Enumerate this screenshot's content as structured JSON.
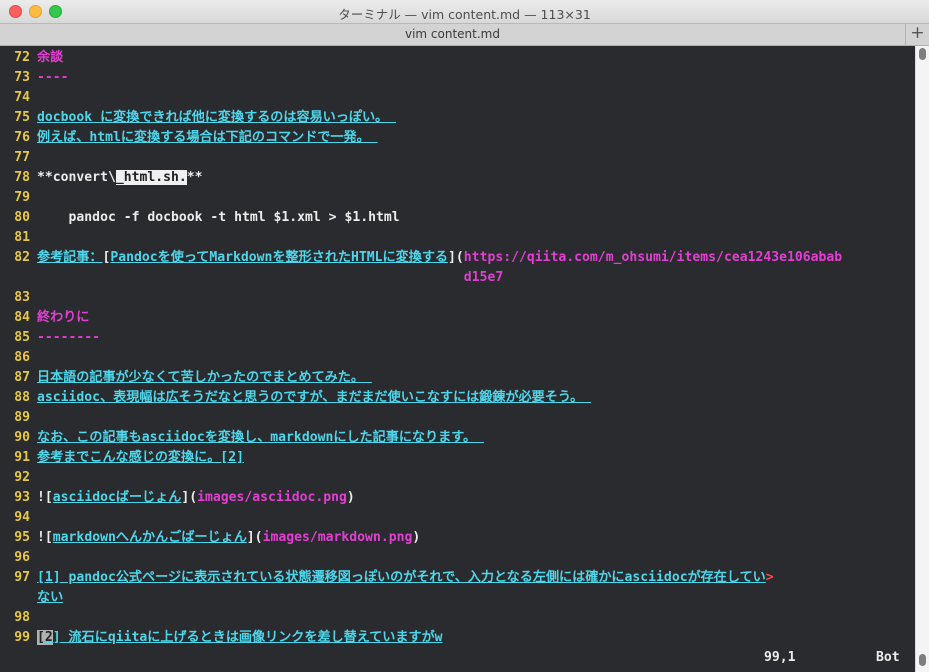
{
  "window": {
    "title": "ターミナル — vim content.md — 113×31",
    "tab_label": "vim content.md",
    "new_tab_label": "+"
  },
  "lines": [
    {
      "n": "72",
      "text": "余談",
      "style": "pink"
    },
    {
      "n": "73",
      "text": "----",
      "style": "pink"
    },
    {
      "n": "74",
      "text": ""
    },
    {
      "n": "75",
      "text": "docbook に変換できれば他に変換するのは容易いっぽい。 ",
      "style": "cyan-u"
    },
    {
      "n": "76",
      "text": "例えば、htmlに変換する場合は下記のコマンドで一発。 ",
      "style": "cyan-u"
    },
    {
      "n": "77",
      "text": ""
    },
    {
      "n": "78a",
      "text": "**convert\\"
    },
    {
      "n": "78b",
      "text": "_html.sh."
    },
    {
      "n": "78c",
      "text": "**"
    },
    {
      "n": "79",
      "text": ""
    },
    {
      "n": "80",
      "text": "    pandoc -f docbook -t html $1.xml > $1.html"
    },
    {
      "n": "81",
      "text": ""
    },
    {
      "n": "82a",
      "text": "参考記事："
    },
    {
      "n": "82b",
      "text": "["
    },
    {
      "n": "82c",
      "text": "Pandocを使ってMarkdownを整形されたHTMLに変換する"
    },
    {
      "n": "82d",
      "text": "]("
    },
    {
      "n": "82e",
      "text": "https://qiita.com/m_ohsumi/items/cea1243e106ababd15e7"
    },
    {
      "n": "82f",
      "text": ")"
    },
    {
      "n": "83",
      "text": ""
    },
    {
      "n": "84",
      "text": "終わりに",
      "style": "pink"
    },
    {
      "n": "85",
      "text": "--------",
      "style": "pink"
    },
    {
      "n": "86",
      "text": ""
    },
    {
      "n": "87",
      "text": "日本語の記事が少なくて苦しかったのでまとめてみた。 ",
      "style": "cyan-u"
    },
    {
      "n": "88",
      "text": "asciidoc、表現幅は広そうだなと思うのですが、まだまだ使いこなすには鍛錬が必要そう。 ",
      "style": "cyan-u"
    },
    {
      "n": "89",
      "text": ""
    },
    {
      "n": "90",
      "text": "なお、この記事もasciidocを変換し、markdownにした記事になります。 ",
      "style": "cyan-u"
    },
    {
      "n": "91",
      "text": "参考までこんな感じの変換に。[2]",
      "style": "cyan-u"
    },
    {
      "n": "92",
      "text": ""
    },
    {
      "n": "93a",
      "text": "!["
    },
    {
      "n": "93b",
      "text": "asciidocばーじょん"
    },
    {
      "n": "93c",
      "text": "]("
    },
    {
      "n": "93d",
      "text": "images/asciidoc.png"
    },
    {
      "n": "93e",
      "text": ")"
    },
    {
      "n": "94",
      "text": ""
    },
    {
      "n": "95a",
      "text": "!["
    },
    {
      "n": "95b",
      "text": "markdownへんかんごばーじょん"
    },
    {
      "n": "95c",
      "text": "]("
    },
    {
      "n": "95d",
      "text": "images/markdown.png"
    },
    {
      "n": "95e",
      "text": ")"
    },
    {
      "n": "96",
      "text": ""
    },
    {
      "n": "97a",
      "text": "[1] pandoc公式ページに表示されている状態遷移図っぽいのがそれで、入力となる左側には確かにasciidocが存在してい"
    },
    {
      "n": "97b",
      "text": ">"
    },
    {
      "n": "97c",
      "text": "ない"
    },
    {
      "n": "98",
      "text": ""
    },
    {
      "n": "99a",
      "text": "[2"
    },
    {
      "n": "99b",
      "text": "]"
    },
    {
      "n": "99c",
      "text": " 流石にqiitaに上げるときは画像リンクを差し替えていますがw"
    }
  ],
  "line_numbers": [
    "72",
    "73",
    "74",
    "75",
    "76",
    "77",
    "78",
    "79",
    "80",
    "81",
    "82",
    "",
    "83",
    "84",
    "85",
    "86",
    "87",
    "88",
    "89",
    "90",
    "91",
    "92",
    "93",
    "94",
    "95",
    "96",
    "97",
    "",
    "98",
    "99"
  ],
  "status": {
    "position": "99,1",
    "scroll": "Bot"
  },
  "colors": {
    "background": "#2a2b2f",
    "line_number": "#e6c84a",
    "heading": "#e23fd2",
    "link": "#4ed6ea",
    "text": "#ececec"
  }
}
